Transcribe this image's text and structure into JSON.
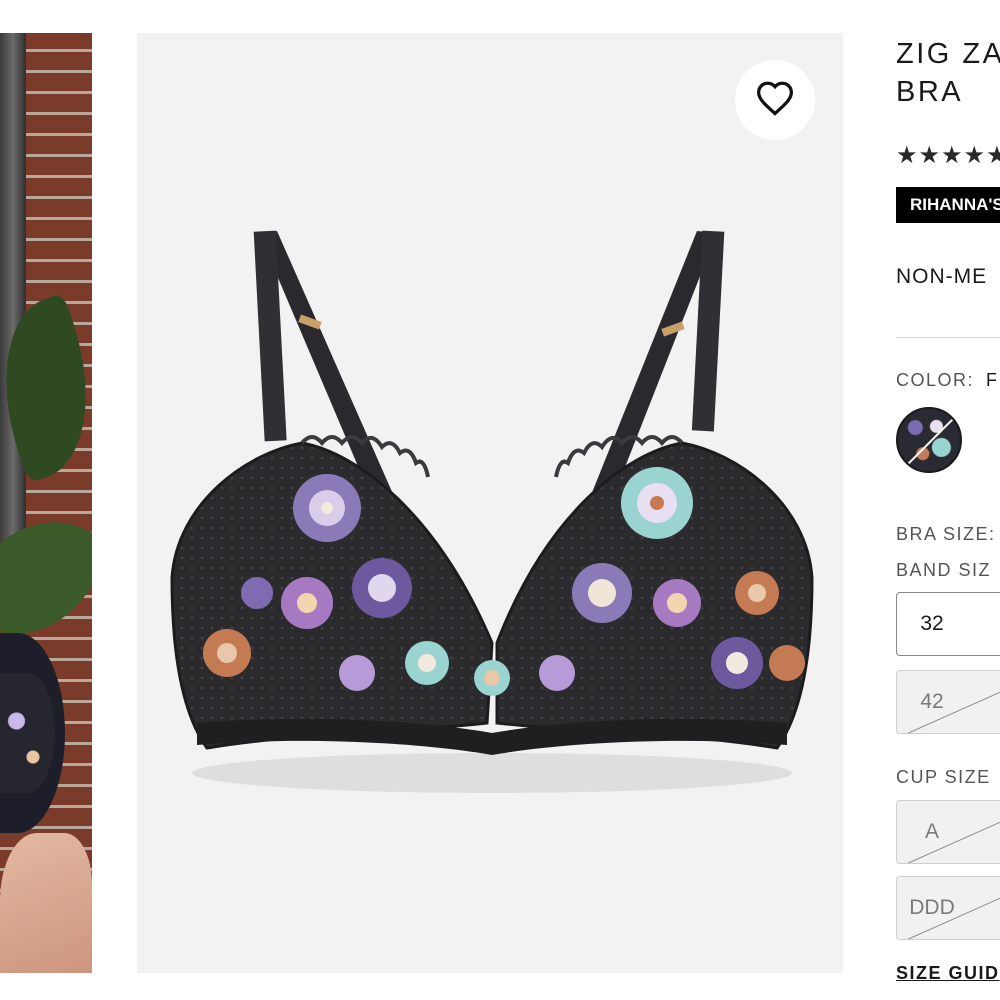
{
  "product": {
    "title": "ZIG ZAG\nBRA",
    "title_line1": "ZIG ZA",
    "title_line2": "BRA",
    "rating_stars": "★★★★★",
    "badge": "RIHANNA'S",
    "subtitle": "NON-ME"
  },
  "color": {
    "label": "COLOR:",
    "value": "F",
    "swatch_icon": "floral-print-swatch"
  },
  "bra_size": {
    "label": "BRA SIZE:",
    "band_label": "BAND SIZ",
    "bands": [
      {
        "label": "32",
        "available": true
      },
      {
        "label": "42",
        "available": false
      }
    ],
    "cup_label": "CUP SIZE",
    "cups": [
      {
        "label": "A",
        "available": false
      },
      {
        "label": "DDD",
        "available": false
      }
    ]
  },
  "size_guide": "SIZE GUID",
  "icons": {
    "favorite": "heart-outline-icon"
  },
  "colors": {
    "badge_bg": "#000000",
    "image_bg": "#f2f2f2",
    "text": "#1a1a1a",
    "muted": "#555555",
    "unavailable_bg": "#f1f1f1"
  }
}
